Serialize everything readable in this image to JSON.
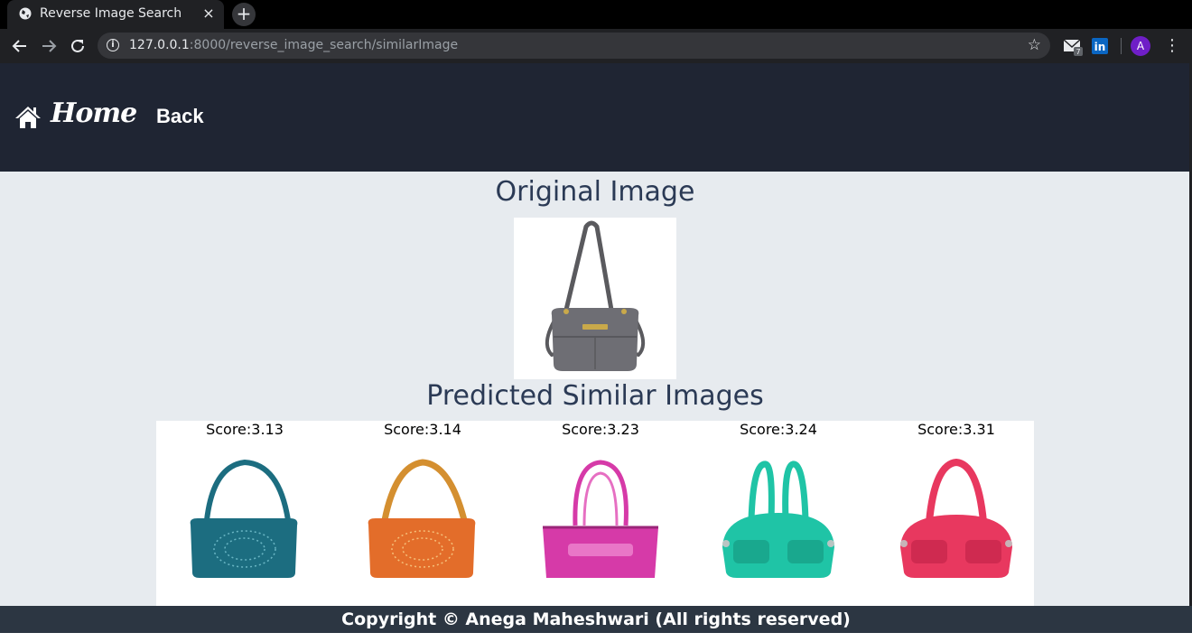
{
  "browser": {
    "tab_title": "Reverse Image Search",
    "tab_close": "×",
    "new_tab": "+",
    "url_host": "127.0.0.1",
    "url_path": ":8000/reverse_image_search/similarImage",
    "avatar_letter": "A",
    "icons": [
      "back-arrow-icon",
      "forward-arrow-icon",
      "reload-icon",
      "info-icon",
      "star-icon",
      "mail-extension-icon",
      "linkedin-extension-icon",
      "menu-icon"
    ]
  },
  "nav": {
    "home_label": "Home",
    "back_label": "Back"
  },
  "main": {
    "original_heading": "Original Image",
    "predicted_heading": "Predicted Similar Images",
    "results": [
      {
        "score": "Score:3.13",
        "color": "#1c6d80",
        "style": "clutch"
      },
      {
        "score": "Score:3.14",
        "color": "#e36d2a",
        "style": "clutch"
      },
      {
        "score": "Score:3.23",
        "color": "#d63aa8",
        "style": "tote"
      },
      {
        "score": "Score:3.24",
        "color": "#1fc4a6",
        "style": "satchel"
      },
      {
        "score": "Score:3.31",
        "color": "#e8385f",
        "style": "satchel"
      }
    ]
  },
  "footer": {
    "text": "Copyright © Anega Maheshwari (All rights reserved)"
  },
  "colors": {
    "navbar": "#1f2533",
    "page_bg": "#e7ebef",
    "heading": "#2b3a55",
    "footer": "#2c3642"
  }
}
